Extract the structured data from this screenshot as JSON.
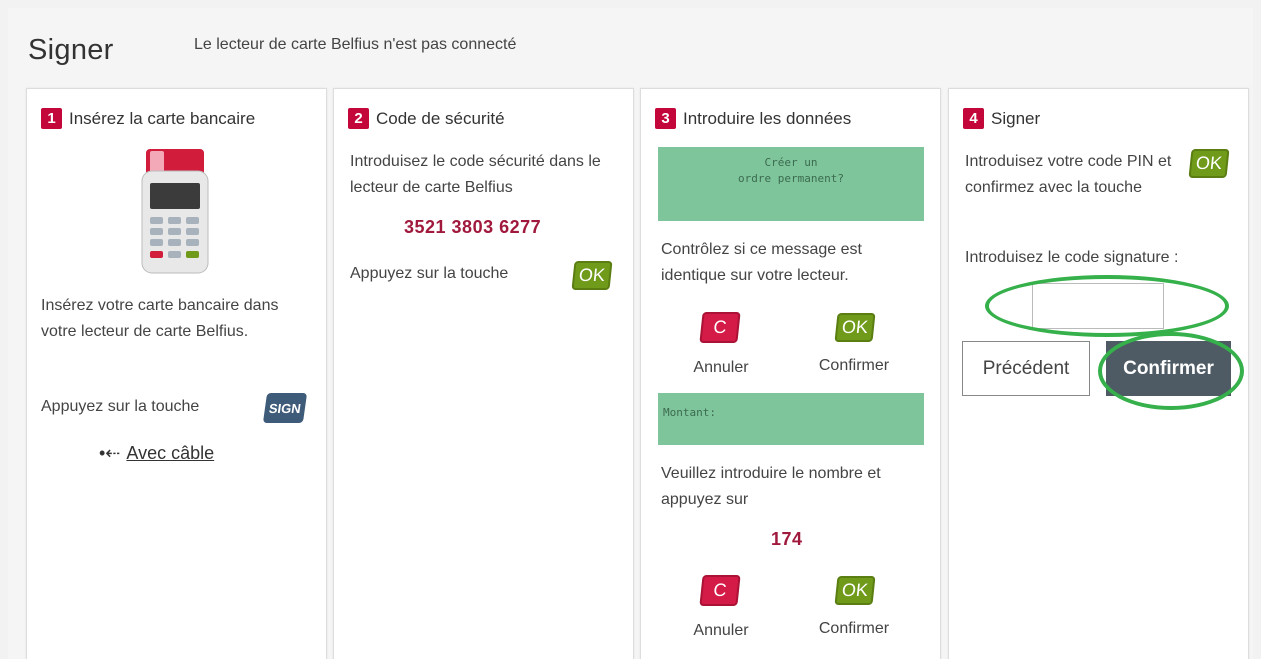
{
  "header": {
    "title": "Signer",
    "status": "Le lecteur de carte Belfius n'est pas connecté"
  },
  "step1": {
    "num": "1",
    "title": "Insérez la carte bancaire",
    "text": "Insérez votre carte bancaire dans votre lecteur de carte Belfius.",
    "press_text": "Appuyez sur la touche",
    "sign_key": "SIGN",
    "usb_link": "Avec câble"
  },
  "step2": {
    "num": "2",
    "title": "Code de sécurité",
    "text": "Introduisez le code sécurité dans le lecteur de carte Belfius",
    "code": "3521 3803 6277",
    "press_text": "Appuyez sur la touche",
    "ok_key": "OK"
  },
  "step3": {
    "num": "3",
    "title": "Introduire les données",
    "lcd1_line1": "Créer un",
    "lcd1_line2": "ordre permanent?",
    "check_text": "Contrôlez si ce message est identique sur votre lecteur.",
    "c_key": "C",
    "ok_key": "OK",
    "cancel_label": "Annuler",
    "confirm_label": "Confirmer",
    "lcd2_text": "Montant:",
    "number_text": "Veuillez introduire le nombre et appuyez sur",
    "number": "174"
  },
  "step4": {
    "num": "4",
    "title": "Signer",
    "text": "Introduisez votre code PIN et confirmez avec la touche",
    "ok_key": "OK",
    "signature_label": "Introduisez le code signature :",
    "signature_value": "",
    "prev_button": "Précédent",
    "confirm_button": "Confirmer"
  },
  "colors": {
    "accent_red": "#c3073a",
    "ok_green": "#6f9a1a",
    "lcd_green": "#7ec59b",
    "highlight_green": "#35b04a",
    "confirm_button": "#4e5b65"
  }
}
